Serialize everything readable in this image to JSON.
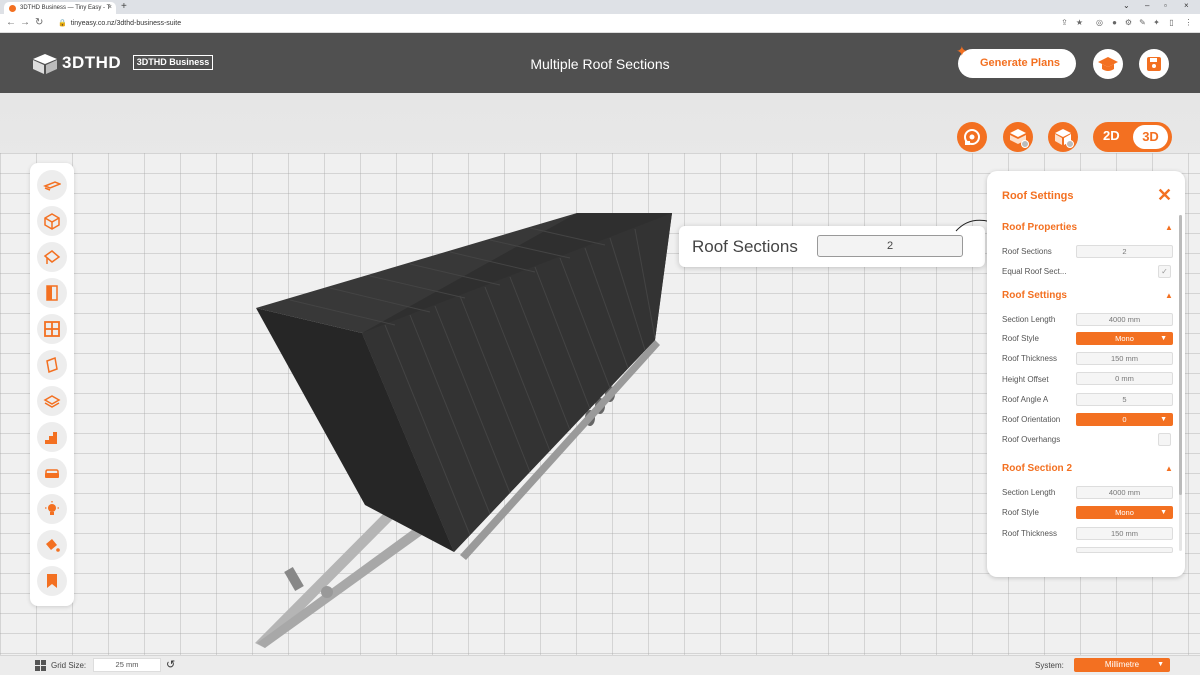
{
  "browser": {
    "tab_title": "3DTHD Business — Tiny Easy - T",
    "url": "tinyeasy.co.nz/3dthd-business-suite"
  },
  "header": {
    "logo": "3DTHD",
    "badge": "3DTHD Business",
    "title": "Multiple Roof Sections",
    "generate_label": "Generate Plans"
  },
  "view_toggle": {
    "label_2d": "2D",
    "label_3d": "3D",
    "active": "3D"
  },
  "callout": {
    "label": "Roof Sections",
    "value": "2"
  },
  "panel": {
    "title": "Roof Settings",
    "sections": {
      "props": {
        "title": "Roof Properties",
        "roof_sections_label": "Roof Sections",
        "roof_sections_value": "2",
        "equal_label": "Equal Roof Sect...",
        "equal_checked": "✓"
      },
      "s1": {
        "title": "Roof Settings",
        "section_length_label": "Section Length",
        "section_length_value": "4000 mm",
        "roof_style_label": "Roof Style",
        "roof_style_value": "Mono",
        "roof_thickness_label": "Roof Thickness",
        "roof_thickness_value": "150 mm",
        "height_offset_label": "Height Offset",
        "height_offset_value": "0 mm",
        "roof_angle_label": "Roof Angle A",
        "roof_angle_value": "5",
        "roof_orientation_label": "Roof Orientation",
        "roof_orientation_value": "0",
        "roof_overhangs_label": "Roof Overhangs"
      },
      "s2": {
        "title": "Roof Section 2",
        "section_length_label": "Section Length",
        "section_length_value": "4000 mm",
        "roof_style_label": "Roof Style",
        "roof_style_value": "Mono",
        "roof_thickness_label": "Roof Thickness",
        "roof_thickness_value": "150 mm"
      }
    }
  },
  "statusbar": {
    "grid_label": "Grid Size:",
    "grid_value": "25 mm",
    "system_label": "System:",
    "system_value": "Millimetre"
  },
  "colors": {
    "accent": "#f37021",
    "header_bg": "#505050",
    "roof": "#2e2e2e"
  }
}
